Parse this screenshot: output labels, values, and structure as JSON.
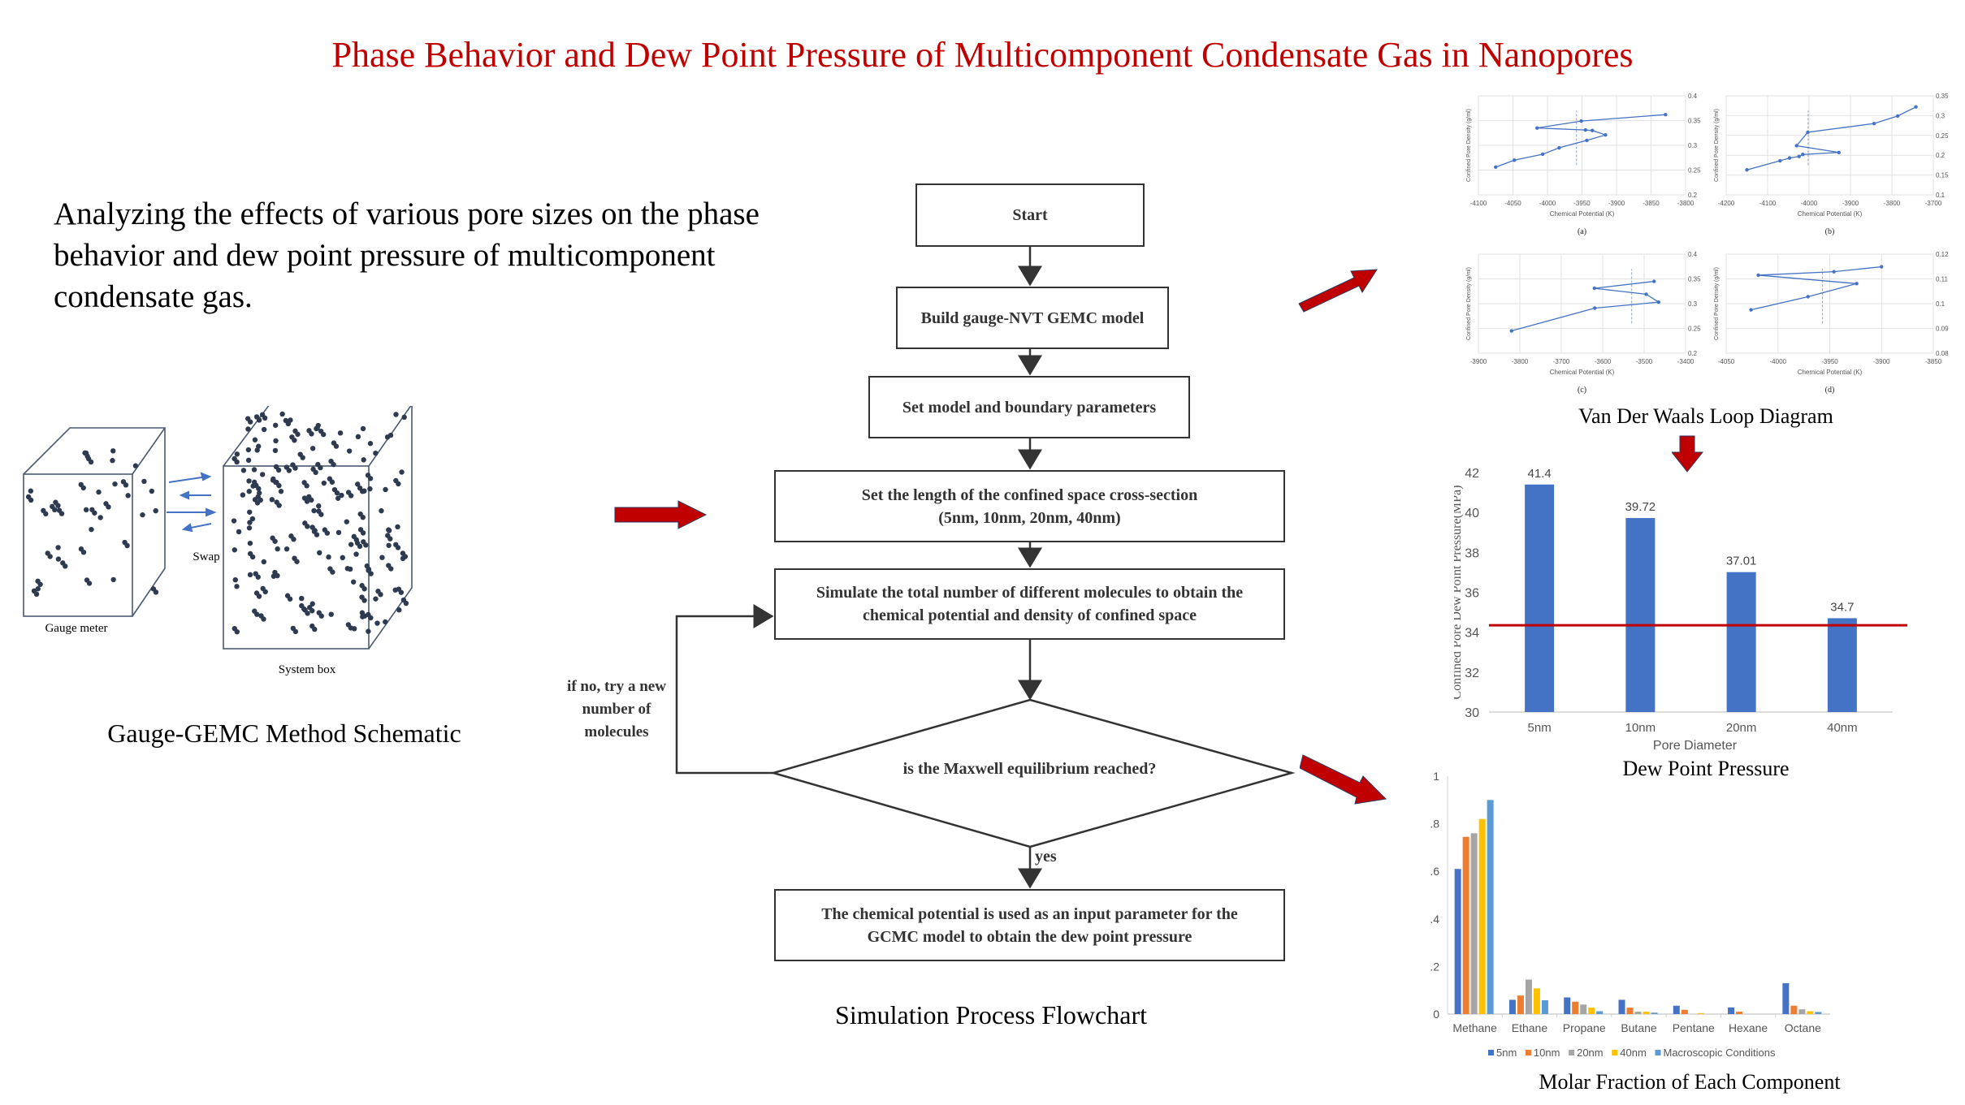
{
  "title": "Phase Behavior and Dew Point Pressure of Multicomponent Condensate Gas in Nanopores",
  "intro": "Analyzing the effects of various pore sizes on the phase behavior and dew point pressure of multicomponent condensate gas.",
  "schematic": {
    "caption": "Gauge-GEMC Method Schematic",
    "gauge_label": "Gauge meter",
    "system_label": "System box",
    "swap_label": "Swap"
  },
  "flowchart": {
    "caption": "Simulation Process Flowchart",
    "steps": [
      "Start",
      "Build gauge-NVT GEMC model",
      "Set model and boundary parameters",
      "Set the length of the confined space cross-section (5nm, 10nm, 20nm, 40nm)",
      "Simulate the total number of different molecules to obtain the chemical potential and density of confined space"
    ],
    "step3_line1": "Set the length of the confined space cross-section",
    "step3_line2": "(5nm, 10nm, 20nm, 40nm)",
    "step4_line1": "Simulate the total number of different molecules to obtain the",
    "step4_line2": "chemical potential and density of confined space",
    "decision": "is the Maxwell equilibrium reached?",
    "no_label_1": "if no, try a new",
    "no_label_2": "number of",
    "no_label_3": "molecules",
    "yes_label": "yes",
    "final_line1": "The chemical potential is used as an input parameter for the",
    "final_line2": "GCMC model to obtain the dew point pressure"
  },
  "colors": {
    "title": "#c00000",
    "arrow": "#c00000",
    "series_line": "#4472c4",
    "bar": "#4472c4",
    "ref_line": "#c00000",
    "s5": "#4472c4",
    "s10": "#ed7d31",
    "s20": "#a5a5a5",
    "s40": "#ffc000",
    "macro": "#5b9bd5"
  },
  "chart_data": [
    {
      "id": "a",
      "type": "line",
      "panel_label": "(a)",
      "xlabel": "Chemical Potential (K)",
      "ylabel": "Confined Pore Density (g/ml)",
      "xlim": [
        -4100,
        -3800
      ],
      "ylim": [
        0.2,
        0.4
      ],
      "xticks": [
        -4100,
        -4050,
        -4000,
        -3950,
        -3900,
        -3850,
        -3800
      ],
      "yticks": [
        0.2,
        0.25,
        0.3,
        0.35,
        0.4
      ],
      "x": [
        -4075,
        -4048,
        -4007,
        -3983,
        -3943,
        -3916,
        -3935,
        -3945,
        -4015,
        -3951,
        -3829
      ],
      "y": [
        0.256,
        0.27,
        0.282,
        0.295,
        0.31,
        0.321,
        0.33,
        0.331,
        0.335,
        0.349,
        0.362
      ],
      "equal_area_x": -3958
    },
    {
      "id": "b",
      "type": "line",
      "panel_label": "(b)",
      "xlabel": "Chemical Potential (K)",
      "ylabel": "Confined Pore Density (g/ml)",
      "xlim": [
        -4200,
        -3700
      ],
      "ylim": [
        0.1,
        0.35
      ],
      "xticks": [
        -4200,
        -4100,
        -4000,
        -3900,
        -3800,
        -3700
      ],
      "yticks": [
        0.1,
        0.15,
        0.2,
        0.25,
        0.3,
        0.35
      ],
      "x": [
        -4150,
        -4070,
        -4047,
        -4024,
        -4015,
        -3928,
        -4030,
        -4003,
        -3843,
        -3786,
        -3742
      ],
      "y": [
        0.163,
        0.186,
        0.193,
        0.197,
        0.202,
        0.207,
        0.224,
        0.258,
        0.28,
        0.299,
        0.322
      ],
      "equal_area_x": -4002
    },
    {
      "id": "c",
      "type": "line",
      "panel_label": "(c)",
      "xlabel": "Chemical Potential (K)",
      "ylabel": "Confined Pore Density (g/ml)",
      "xlim": [
        -3900,
        -3400
      ],
      "ylim": [
        0.2,
        0.4
      ],
      "xticks": [
        -3900,
        -3800,
        -3700,
        -3600,
        -3500,
        -3400
      ],
      "yticks": [
        0.2,
        0.25,
        0.3,
        0.35,
        0.4
      ],
      "x": [
        -3820,
        -3619,
        -3465,
        -3495,
        -3620,
        -3476
      ],
      "y": [
        0.245,
        0.291,
        0.303,
        0.319,
        0.331,
        0.345
      ],
      "equal_area_x": -3530
    },
    {
      "id": "d",
      "type": "line",
      "panel_label": "(d)",
      "xlabel": "Chemical Potential (K)",
      "ylabel": "Confined Pore Density (g/ml)",
      "xlim": [
        -4050,
        -3850
      ],
      "ylim": [
        0.08,
        0.12
      ],
      "xticks": [
        -4050,
        -4000,
        -3950,
        -3900,
        -3850
      ],
      "yticks": [
        0.08,
        0.09,
        0.1,
        0.11,
        0.12
      ],
      "x": [
        -4026,
        -3971,
        -3924,
        -4019,
        -3946,
        -3900
      ],
      "y": [
        0.0975,
        0.1028,
        0.1081,
        0.1115,
        0.1129,
        0.1149
      ],
      "equal_area_x": -3957
    },
    {
      "id": "dew",
      "type": "bar",
      "title": "Dew Point Pressure",
      "xlabel": "Pore Diameter",
      "ylabel": "Confined Pore Dew Point Pressure(MPa)",
      "categories": [
        "5nm",
        "10nm",
        "20nm",
        "40nm"
      ],
      "values": [
        41.4,
        39.72,
        37.01,
        34.7
      ],
      "data_labels": [
        "41.4",
        "39.72",
        "37.01",
        "34.7"
      ],
      "ylim": [
        30,
        42
      ],
      "yticks": [
        30,
        32,
        34,
        36,
        38,
        40,
        42
      ],
      "reference_line": 34.35
    },
    {
      "id": "molar",
      "type": "bar",
      "title": "Molar Fraction of  Each Component",
      "categories": [
        "Methane",
        "Ethane",
        "Propane",
        "Butane",
        "Pentane",
        "Hexane",
        "Octane"
      ],
      "ylim": [
        0,
        1
      ],
      "yticks": [
        0,
        0.2,
        0.4,
        0.6,
        0.8,
        1
      ],
      "yticklabels": [
        "0",
        "0.2",
        "0.4",
        "0.6",
        "0.8",
        "1"
      ],
      "legend_position": "bottom",
      "series": [
        {
          "name": "5nm",
          "color_key": "s5",
          "values": [
            0.61,
            0.06,
            0.07,
            0.06,
            0.035,
            0.028,
            0.13
          ]
        },
        {
          "name": "10nm",
          "color_key": "s10",
          "values": [
            0.745,
            0.078,
            0.052,
            0.027,
            0.018,
            0.01,
            0.035
          ]
        },
        {
          "name": "20nm",
          "color_key": "s20",
          "values": [
            0.76,
            0.145,
            0.04,
            0.01,
            0.0,
            0.0,
            0.02
          ]
        },
        {
          "name": "40nm",
          "color_key": "s40",
          "values": [
            0.82,
            0.108,
            0.027,
            0.01,
            0.004,
            0.0,
            0.012
          ]
        },
        {
          "name": "Macroscopic Conditions",
          "color_key": "macro",
          "values": [
            0.9,
            0.058,
            0.012,
            0.006,
            0.0,
            0.0,
            0.009
          ]
        }
      ]
    }
  ],
  "vdw_caption": "Van Der Waals Loop Diagram",
  "dew_caption": "Dew Point Pressure",
  "molar_caption": "Molar Fraction of  Each Component"
}
